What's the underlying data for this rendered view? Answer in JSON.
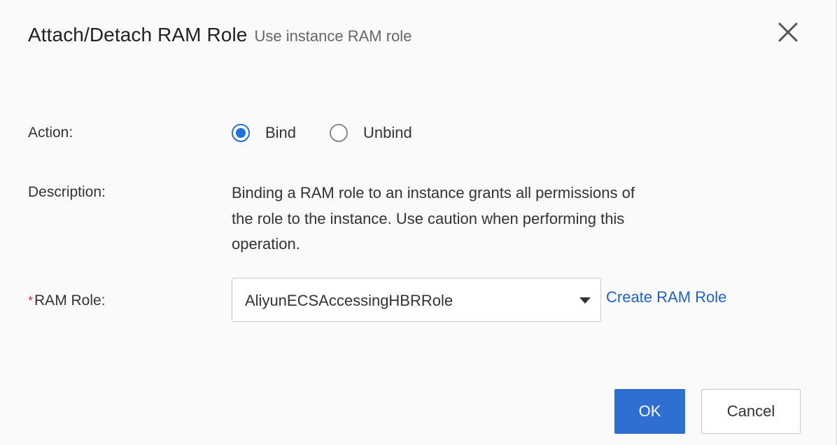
{
  "dialog": {
    "title": "Attach/Detach RAM Role",
    "subtitle": "Use instance RAM role",
    "close_icon": "close-icon"
  },
  "form": {
    "action": {
      "label": "Action:",
      "options": [
        {
          "label": "Bind",
          "checked": true
        },
        {
          "label": "Unbind",
          "checked": false
        }
      ]
    },
    "description": {
      "label": "Description:",
      "text": "Binding a RAM role to an instance grants all permissions of the role to the instance. Use caution when performing this operation."
    },
    "ram_role": {
      "required_mark": "*",
      "label": "RAM Role:",
      "selected_value": "AliyunECSAccessingHBRRole",
      "create_link": "Create RAM Role"
    }
  },
  "footer": {
    "ok_label": "OK",
    "cancel_label": "Cancel"
  },
  "colors": {
    "accent": "#2f6fd1",
    "link": "#1f62c8",
    "required": "#d9363e"
  }
}
